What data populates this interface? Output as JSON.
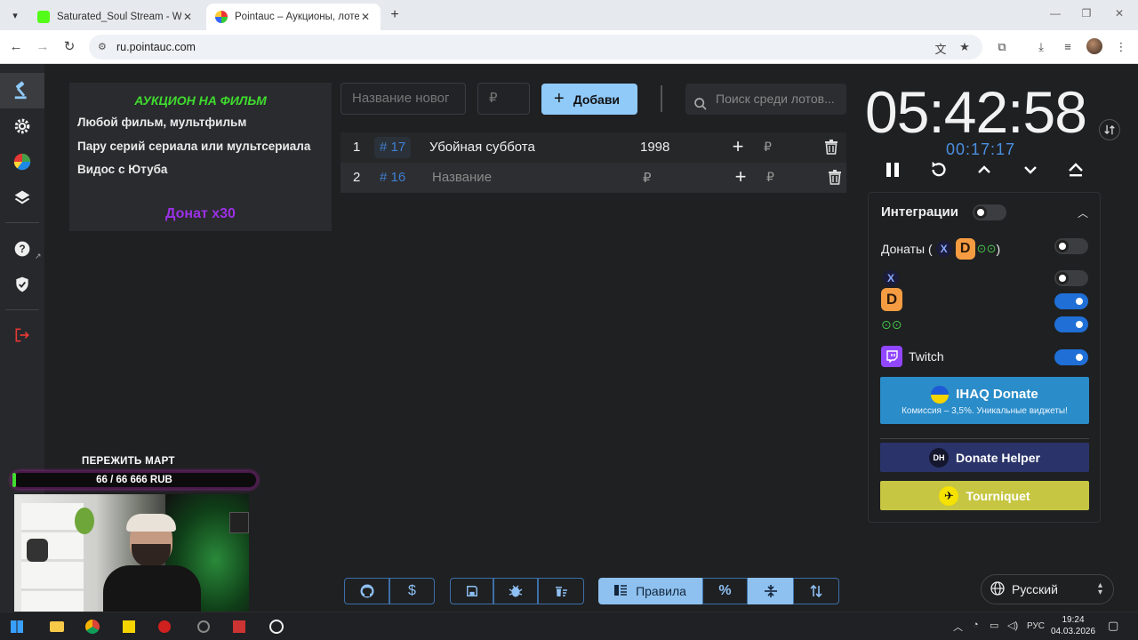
{
  "browser": {
    "tabs": [
      {
        "title": "Saturated_Soul Stream - Watch",
        "active": false
      },
      {
        "title": "Pointauc – Аукционы, лотереи",
        "active": true
      }
    ],
    "url": "ru.pointauc.com"
  },
  "rules": {
    "title": "АУКЦИОН НА ФИЛЬМ",
    "lines": [
      "Любой фильм, мультфильм",
      "Пару серий сериала или мультсериала",
      "Видос с Ютуба"
    ],
    "donate": "Донат x30"
  },
  "form": {
    "name_placeholder": "Название новог",
    "amount_placeholder": "₽",
    "add_label": "Добавить",
    "search_placeholder": "Поиск среди лотов..."
  },
  "lots": [
    {
      "num": "1",
      "id": "# 17",
      "name": "Убойная суббота",
      "amount": "1998",
      "currency": "₽"
    },
    {
      "num": "2",
      "id": "# 16",
      "name": "Название",
      "amount": "₽",
      "currency": "₽"
    }
  ],
  "timer": {
    "main": "05:42:58",
    "sub": "00:17:17"
  },
  "integrations": {
    "title": "Интеграции",
    "donations_label": "Донаты (",
    "donations_close": ")",
    "twitch_label": "Twitch",
    "ihaq_title": "IHAQ Donate",
    "ihaq_sub": "Комиссия – 3,5%. Уникальные виджеты!",
    "donate_helper": "Donate Helper",
    "tourniquet": "Tourniquet"
  },
  "toolbar": {
    "rules_label": "Правила",
    "percent_label": "%",
    "dollar_label": "$"
  },
  "language": "Русский",
  "overlay": {
    "goal_title": "ПЕРЕЖИТЬ МАРТ",
    "goal_progress": "66 / 66 666 RUB",
    "goal_fraction": 0.001
  },
  "taskbar": {
    "time": "19:24",
    "date": "04.03.2026",
    "lang": "РУС"
  },
  "colors": {
    "accent": "#90caf9",
    "toggle_on": "#1f6fd6",
    "rules_title": "#3fdc2e",
    "donate": "#9b30e6",
    "ihaq": "#2a8cc8",
    "donate_helper": "#2b346a",
    "tourniquet": "#c6c642"
  }
}
